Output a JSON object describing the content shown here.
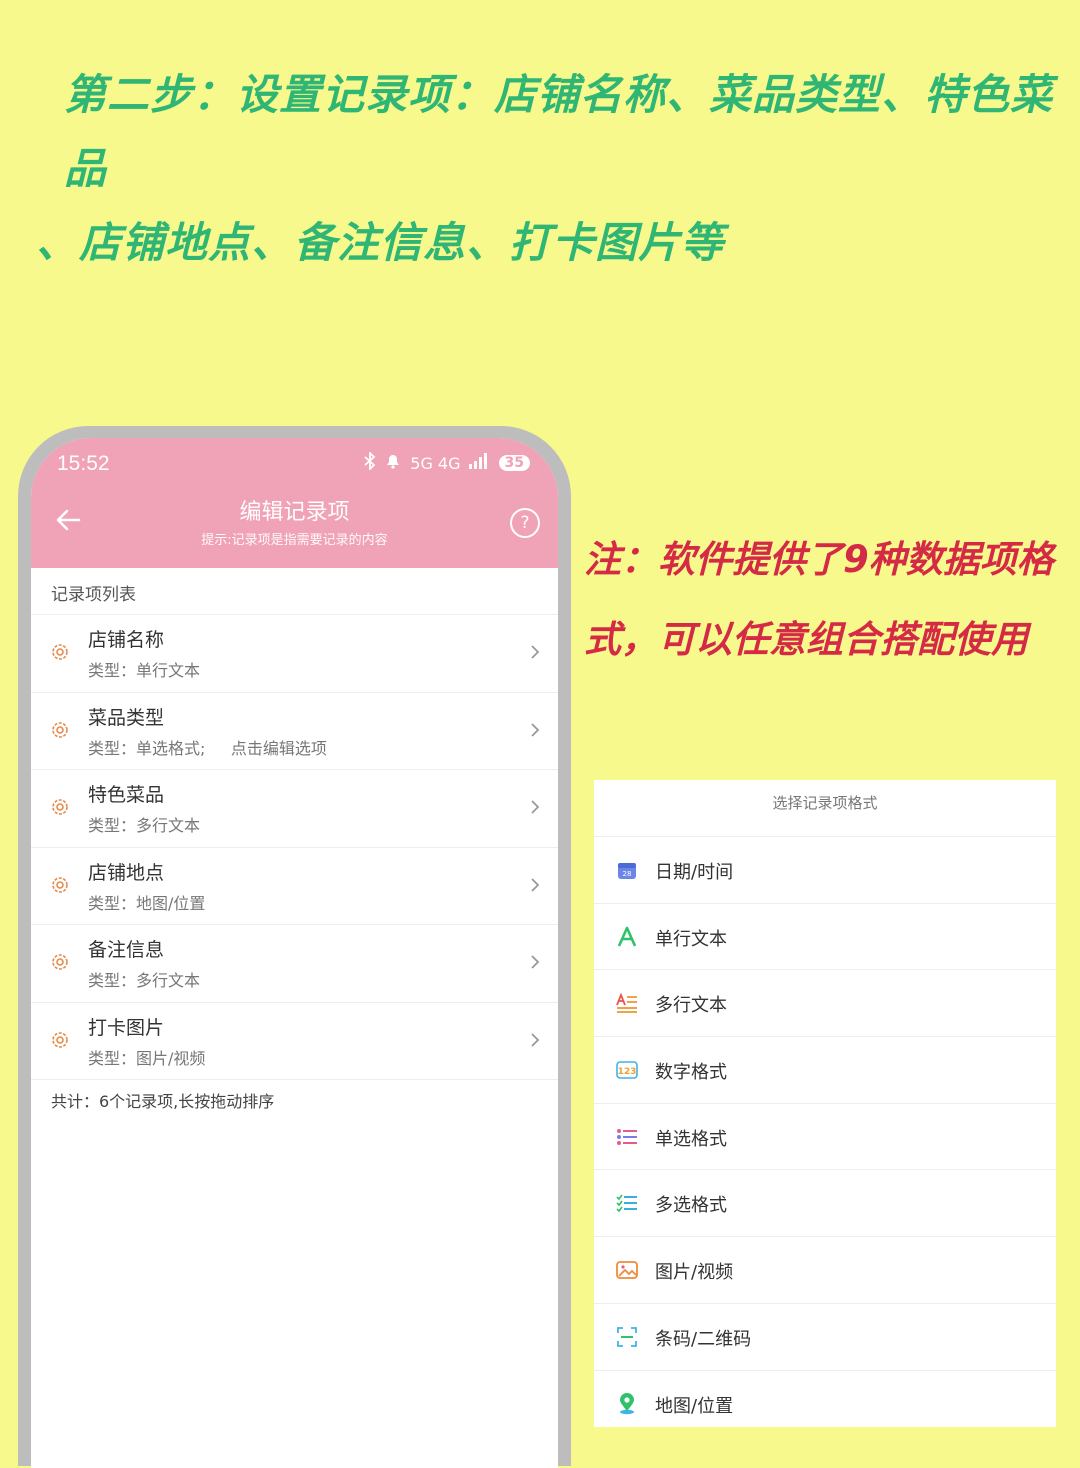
{
  "headline": {
    "line1": "第二步：设置记录项：店铺名称、菜品类型、特色菜品",
    "line2": "、店铺地点、备注信息、打卡图片等"
  },
  "phone": {
    "status": {
      "time": "15:52",
      "network": "5G 4G",
      "battery": "35"
    },
    "appbar": {
      "title": "编辑记录项",
      "subtitle": "提示:记录项是指需要记录的内容",
      "help": "?"
    },
    "list_header": "记录项列表",
    "items": [
      {
        "name": "店铺名称",
        "type": "类型：单行文本"
      },
      {
        "name": "菜品类型",
        "type": "类型：单选格式;     点击编辑选项"
      },
      {
        "name": "特色菜品",
        "type": "类型：多行文本"
      },
      {
        "name": "店铺地点",
        "type": "类型：地图/位置"
      },
      {
        "name": "备注信息",
        "type": "类型：多行文本"
      },
      {
        "name": "打卡图片",
        "type": "类型：图片/视频"
      }
    ],
    "total": "共计：6个记录项,长按拖动排序"
  },
  "note": "注：软件提供了9种数据项格式，可以任意组合搭配使用",
  "format_card": {
    "title": "选择记录项格式",
    "options": [
      {
        "label": "日期/时间",
        "icon": "calendar-icon",
        "color": "#6b86e8"
      },
      {
        "label": "单行文本",
        "icon": "letter-a-icon",
        "color": "#2fc26b"
      },
      {
        "label": "多行文本",
        "icon": "multiline-text-icon",
        "color": "#f0a24a"
      },
      {
        "label": "数字格式",
        "icon": "number-123-icon",
        "color": "#3fb4e8"
      },
      {
        "label": "单选格式",
        "icon": "single-choice-list-icon",
        "color": "#e85a8a"
      },
      {
        "label": "多选格式",
        "icon": "multi-choice-list-icon",
        "color": "#3aaee0"
      },
      {
        "label": "图片/视频",
        "icon": "image-icon",
        "color": "#f08a3a"
      },
      {
        "label": "条码/二维码",
        "icon": "scan-code-icon",
        "color": "#3fb4e8"
      },
      {
        "label": "地图/位置",
        "icon": "map-pin-icon",
        "color": "#2fc26b"
      }
    ]
  }
}
